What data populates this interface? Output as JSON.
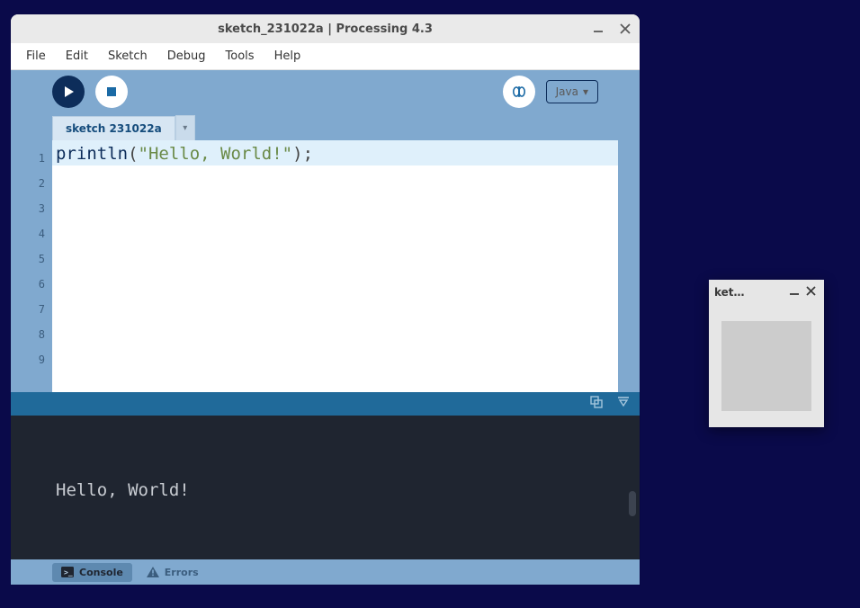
{
  "main_window": {
    "title": "sketch_231022a | Processing 4.3",
    "menu": {
      "file": "File",
      "edit": "Edit",
      "sketch": "Sketch",
      "debug": "Debug",
      "tools": "Tools",
      "help": "Help"
    },
    "toolbar": {
      "run_icon": "run",
      "stop_icon": "stop",
      "debug_icon": "debug",
      "mode_label": "Java",
      "mode_caret": "▾"
    },
    "tabs": {
      "active": "sketch 231022a",
      "dropdown_caret": "▾"
    },
    "editor": {
      "line_numbers": [
        "1",
        "2",
        "3",
        "4",
        "5",
        "6",
        "7",
        "8",
        "9"
      ],
      "code_line1": {
        "func": "println",
        "open": "(",
        "string": "\"Hello, World!\"",
        "close_semi": ");"
      }
    },
    "console": {
      "output": "Hello, World!"
    },
    "bottom_tabs": {
      "console": "Console",
      "errors": "Errors"
    }
  },
  "sketch_window": {
    "title": "ket…"
  }
}
